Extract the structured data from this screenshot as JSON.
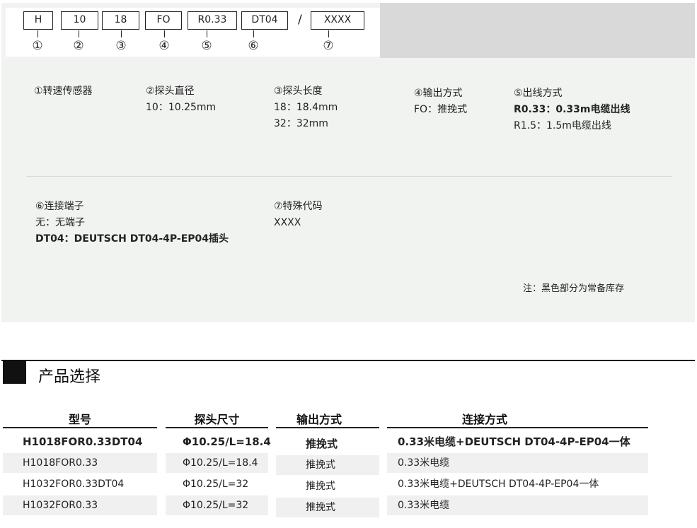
{
  "code": {
    "segments": [
      {
        "text": "H",
        "num": "①"
      },
      {
        "text": "10",
        "num": "②"
      },
      {
        "text": "18",
        "num": "③"
      },
      {
        "text": "FO",
        "num": "④"
      },
      {
        "text": "R0.33",
        "num": "⑤"
      },
      {
        "text": "DT04",
        "num": "⑥"
      },
      {
        "text": "XXXX",
        "num": "⑦"
      }
    ],
    "separator": "/"
  },
  "descriptions": {
    "d1": {
      "title": "①转速传感器"
    },
    "d2": {
      "title": "②探头直径",
      "lines": [
        "10：10.25mm"
      ]
    },
    "d3": {
      "title": "③探头长度",
      "lines": [
        "18：18.4mm",
        "32：32mm"
      ]
    },
    "d4": {
      "title": "④输出方式",
      "lines": [
        "FO：推挽式"
      ]
    },
    "d5": {
      "title": "⑤出线方式",
      "lines": [
        "R0.33：0.33m电缆出线",
        "R1.5：1.5m电缆出线"
      ]
    },
    "d6": {
      "title": "⑥连接端子",
      "lines": [
        "无：无端子",
        "DT04：DEUTSCH DT04-4P-EP04插头"
      ]
    },
    "d7": {
      "title": "⑦特殊代码",
      "lines": [
        "XXXX"
      ]
    }
  },
  "note": "注：黑色部分为常备库存",
  "selection": {
    "title": "产品选择",
    "headers": [
      "型号",
      "探头尺寸",
      "输出方式",
      "连接方式"
    ],
    "rows": [
      [
        "H1018FOR0.33DT04",
        "Φ10.25/L=18.4",
        "推挽式",
        "0.33米电缆+DEUTSCH DT04-4P-EP04一体"
      ],
      [
        "H1018FOR0.33",
        "Φ10.25/L=18.4",
        "推挽式",
        "0.33米电缆"
      ],
      [
        "H1032FOR0.33DT04",
        "Φ10.25/L=32",
        "推挽式",
        "0.33米电缆+DEUTSCH DT04-4P-EP04一体"
      ],
      [
        "H1032FOR0.33",
        "Φ10.25/L=32",
        "推挽式",
        "0.33米电缆"
      ]
    ]
  }
}
